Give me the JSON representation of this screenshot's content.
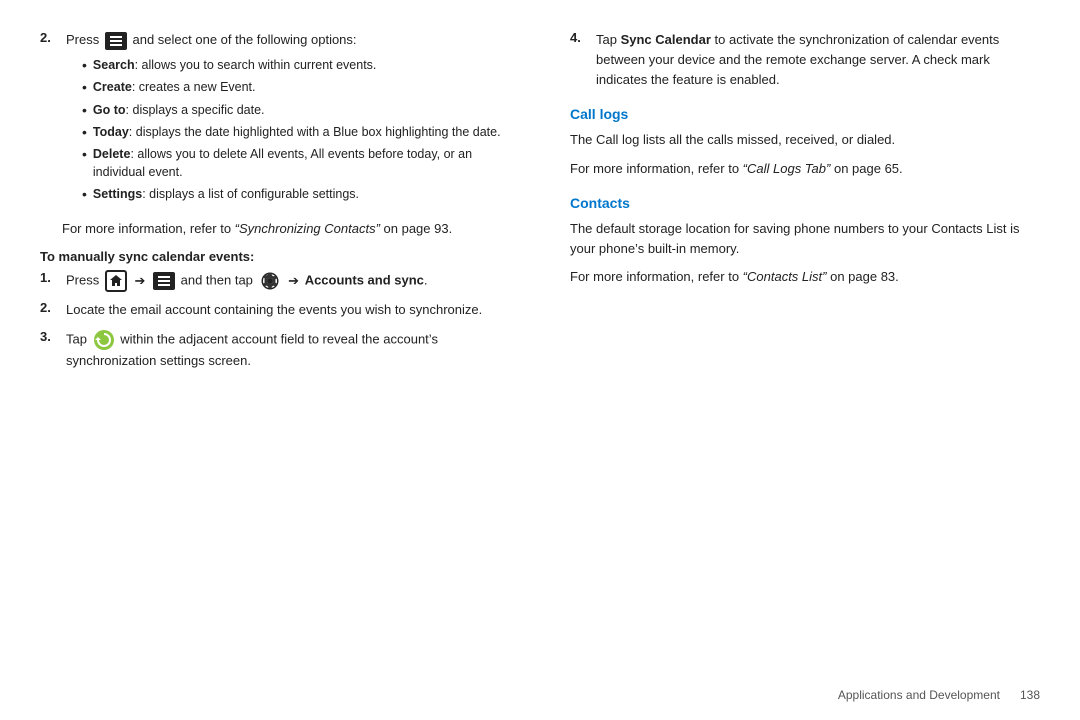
{
  "left": {
    "step2_prefix": "Press",
    "step2_suffix": "and select one of the following options:",
    "bullets": [
      {
        "label": "Search",
        "desc": ": allows you to search within current events."
      },
      {
        "label": "Create",
        "desc": ": creates a new Event."
      },
      {
        "label": "Go to",
        "desc": ": displays a specific date."
      },
      {
        "label": "Today",
        "desc": ": displays the date highlighted with a Blue box highlighting the date."
      },
      {
        "label": "Delete",
        "desc": ": allows you to delete All events, All events before today, or an individual event."
      },
      {
        "label": "Settings",
        "desc": ": displays a list of configurable settings."
      }
    ],
    "more_info": "For more information, refer to ",
    "more_info_link": "“Synchronizing Contacts”",
    "more_info_suffix": " on page 93.",
    "subheading": "To manually sync calendar events:",
    "sub_step1_prefix": "Press",
    "sub_step1_middle": "and then tap",
    "sub_step1_suffix": "→ Accounts and sync.",
    "sub_step2": "Locate the email account containing the events you wish to synchronize.",
    "sub_step3_prefix": "Tap",
    "sub_step3_suffix": "within the adjacent account field to reveal the account’s synchronization settings screen."
  },
  "right": {
    "step4_prefix": "Tap ",
    "step4_bold": "Sync Calendar",
    "step4_text": " to activate the synchronization of calendar events between your device and the remote exchange server. A check mark indicates the feature is enabled.",
    "call_logs_heading": "Call logs",
    "call_logs_p1": "The Call log lists all the calls missed, received, or dialed.",
    "call_logs_p2_prefix": "For more information, refer to ",
    "call_logs_p2_link": "“Call Logs Tab”",
    "call_logs_p2_suffix": " on page 65.",
    "contacts_heading": "Contacts",
    "contacts_p1": "The default storage location for saving phone numbers to your Contacts List is your phone’s built-in memory.",
    "contacts_p2_prefix": "For more information, refer to ",
    "contacts_p2_link": "“Contacts List”",
    "contacts_p2_suffix": " on page 83."
  },
  "footer": {
    "label": "Applications and Development",
    "page": "138"
  }
}
